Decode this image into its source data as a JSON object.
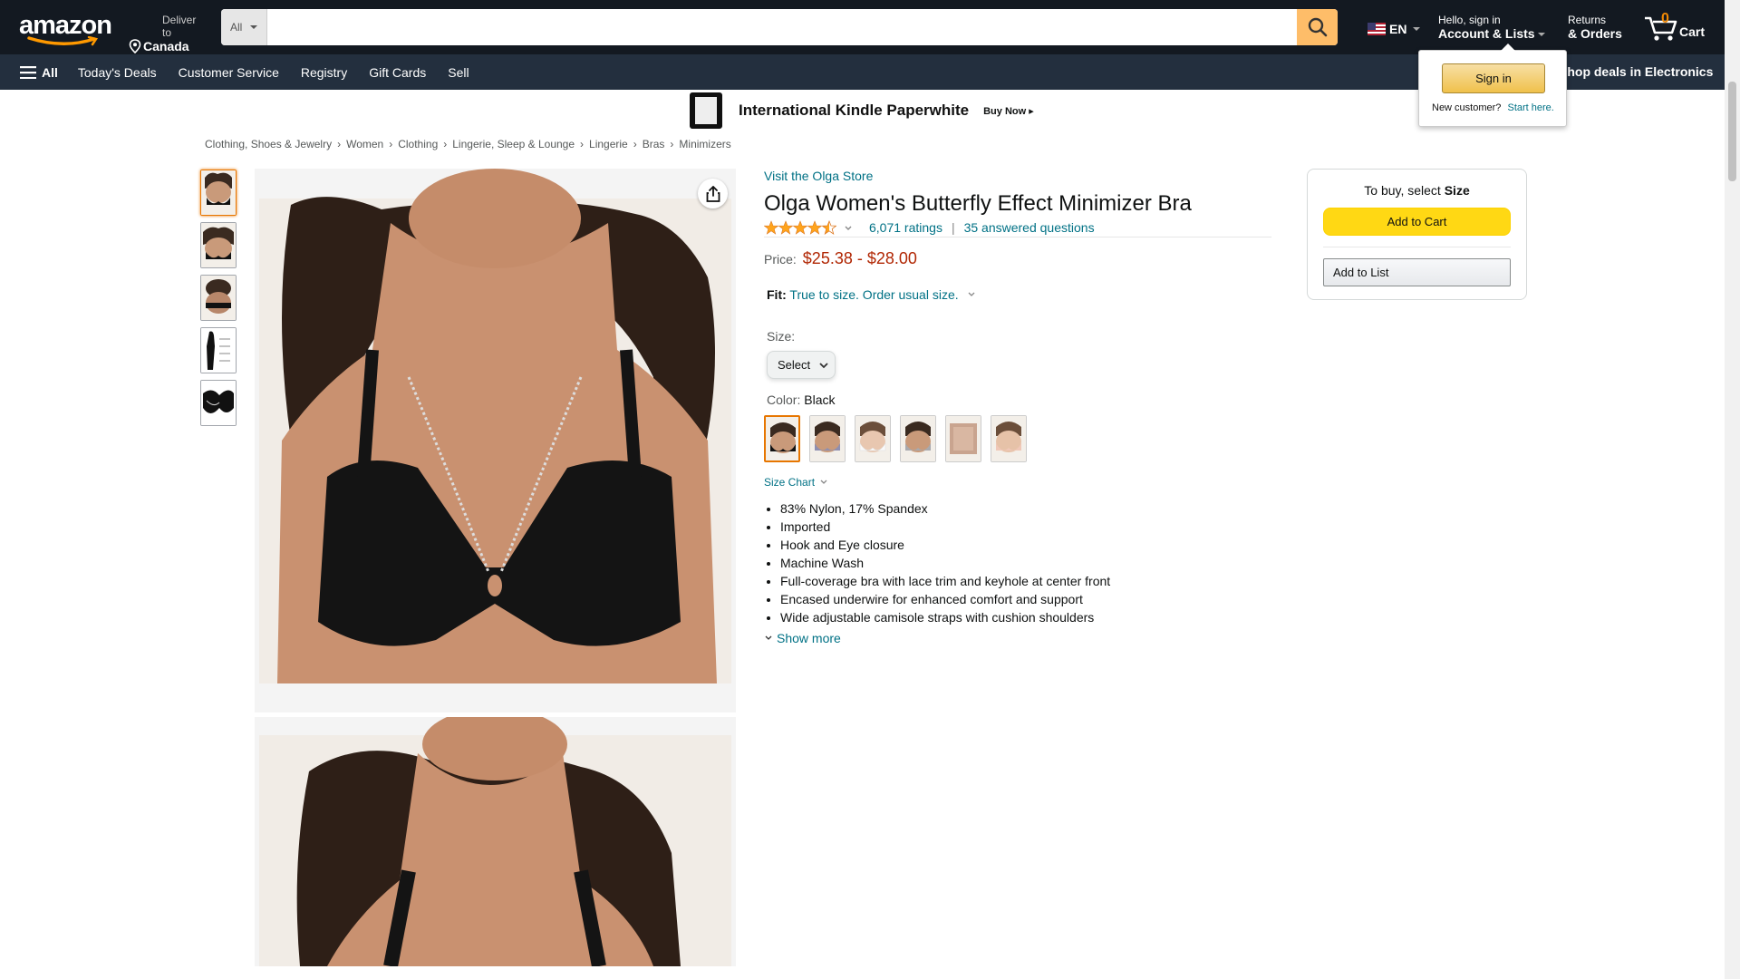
{
  "header": {
    "logo_text": "amazon",
    "deliver_label": "Deliver to",
    "deliver_location": "Canada",
    "search_category": "All",
    "search_placeholder": "",
    "language": "EN",
    "account_greeting": "Hello, sign in",
    "account_label": "Account & Lists",
    "returns_label": "Returns",
    "orders_label": "& Orders",
    "cart_count": "0",
    "cart_label": "Cart"
  },
  "subnav": {
    "all_label": "All",
    "items": [
      "Today's Deals",
      "Customer Service",
      "Registry",
      "Gift Cards",
      "Sell"
    ],
    "promo": "Shop deals in Electronics"
  },
  "signin_flyout": {
    "button": "Sign in",
    "new_customer": "New customer?",
    "start_here": "Start here."
  },
  "banner": {
    "title": "International Kindle Paperwhite",
    "cta": "Buy Now ▸"
  },
  "breadcrumb": [
    "Clothing, Shoes & Jewelry",
    "Women",
    "Clothing",
    "Lingerie, Sleep & Lounge",
    "Lingerie",
    "Bras",
    "Minimizers"
  ],
  "product": {
    "store_link": "Visit the Olga Store",
    "title": "Olga Women's Butterfly Effect Minimizer Bra",
    "rating_stars": 4.5,
    "ratings_count": "6,071 ratings",
    "answered": "35 answered questions",
    "price_label": "Price:",
    "price": "$25.38 - $28.00",
    "fit_label": "Fit:",
    "fit_text": "True to size. Order usual size.",
    "size_label": "Size:",
    "size_select": "Select",
    "color_label": "Color:",
    "color_value": "Black",
    "size_chart": "Size Chart",
    "bullets": [
      "83% Nylon, 17% Spandex",
      "Imported",
      "Hook and Eye closure",
      "Machine Wash",
      "Full-coverage bra with lace trim and keyhole at center front",
      "Encased underwire for enhanced comfort and support",
      "Wide adjustable camisole straps with cushion shoulders"
    ],
    "show_more": "Show more"
  },
  "buybox": {
    "to_buy": "To buy, select",
    "to_buy_bold": "Size",
    "add_to_cart": "Add to Cart",
    "add_to_list": "Add to List"
  },
  "colors": {
    "nav_bg": "#131921",
    "subnav_bg": "#232f3e",
    "search_btn": "#febd69",
    "price": "#b12704",
    "link": "#007185",
    "add_cart": "#ffd814",
    "swatches": [
      "#1a1a1a",
      "#8f8fb0",
      "#f3f1ee",
      "#a9a9ad",
      "#c9a48f",
      "#f0c8b8"
    ]
  }
}
